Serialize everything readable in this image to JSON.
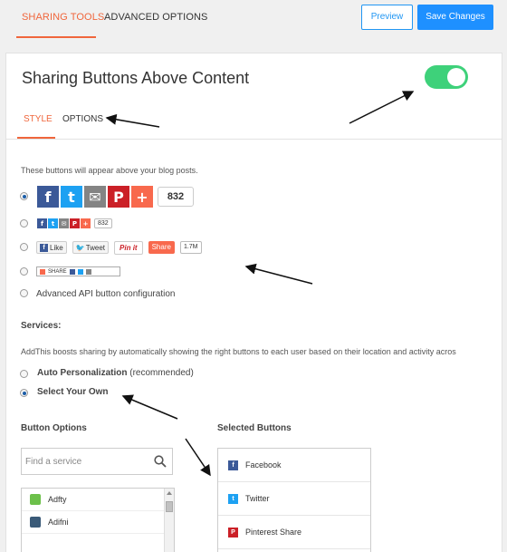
{
  "topbar": {
    "tabs": [
      {
        "label": "SHARING TOOLS",
        "active": true
      },
      {
        "label": "ADVANCED OPTIONS",
        "active": false
      }
    ],
    "preview_label": "Preview",
    "save_label": "Save Changes"
  },
  "card": {
    "title": "Sharing Buttons Above Content",
    "enabled": true,
    "subtabs": [
      {
        "label": "STYLE",
        "active": true
      },
      {
        "label": "OPTIONS",
        "active": false
      }
    ],
    "description": "These buttons will appear above your blog posts.",
    "styles": {
      "selected_index": 0,
      "large_count": "832",
      "small_count": "832",
      "native": {
        "like_label": "Like",
        "tweet_label": "Tweet",
        "pinit_label": "Pin it",
        "share_label": "Share",
        "count": "1.7M"
      },
      "compact_label": "SHARE",
      "api_label": "Advanced API button configuration"
    },
    "services": {
      "heading": "Services:",
      "description": "AddThis boosts sharing by automatically showing the right buttons to each user based on their location and activity acros",
      "options": [
        {
          "label": "Auto Personalization",
          "note": "(recommended)",
          "checked": false
        },
        {
          "label": "Select Your Own",
          "note": "",
          "checked": true
        }
      ]
    },
    "button_options": {
      "heading": "Button Options",
      "search_placeholder": "Find a service",
      "items": [
        {
          "label": "Adfty",
          "color": "#6cc04a"
        },
        {
          "label": "Adifni",
          "color": "#3a5a78"
        }
      ]
    },
    "selected_buttons": {
      "heading": "Selected Buttons",
      "items": [
        {
          "label": "Facebook",
          "icon": "facebook-icon",
          "color": "#3b5998"
        },
        {
          "label": "Twitter",
          "icon": "twitter-icon",
          "color": "#1da1f2"
        },
        {
          "label": "Pinterest Share",
          "icon": "pinterest-icon",
          "color": "#cb2027"
        }
      ]
    }
  },
  "colors": {
    "accent_orange": "#f0663c",
    "primary_blue": "#1e90ff",
    "toggle_green": "#3ed17a"
  }
}
